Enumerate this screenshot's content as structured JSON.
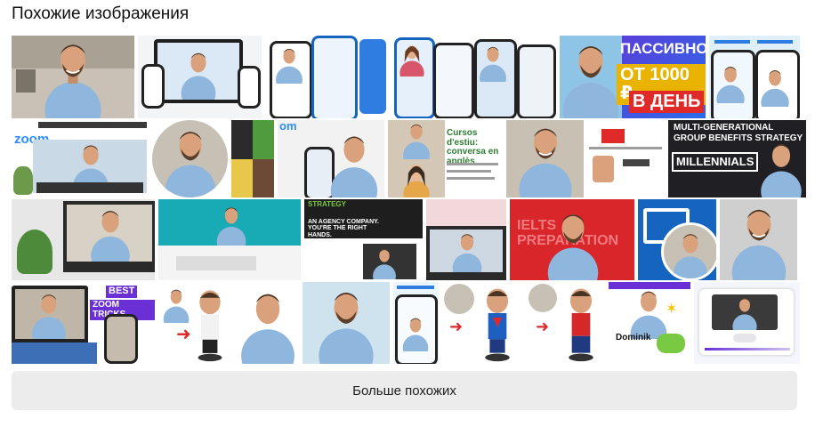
{
  "header": {
    "title": "Похожие изображения"
  },
  "overlays": {
    "passivno_1": "ПАССИВНО",
    "passivno_2": "ОТ 1000 ₽",
    "passivno_3": "В ДЕНЬ",
    "zoom_logo": "zoom",
    "om_logo": "om",
    "cursos_title": "Cursos d'estiu: conversa en anglès",
    "mg_line1": "MULTI-GENERATIONAL",
    "mg_line2": "GROUP BENEFITS STRATEGY",
    "mg_line3": "MILLENNIALS",
    "agency_title": "AN AGENCY COMPANY. YOU'RE THE RIGHT HANDS.",
    "strategy_logo": "STRATEGY",
    "ielts": "IELTS PREPARATION",
    "best_zoom_1": "BEST",
    "best_zoom_2": "ZOOM TRICKS",
    "dominik": "Dominik"
  },
  "actions": {
    "more_label": "Больше похожих"
  },
  "colors": {
    "shirt": "#8fb6dc",
    "skin": "#d9a27c",
    "hair": "#4a3423",
    "purple": "#6b2fd6",
    "red": "#e02a2a",
    "blue": "#1565c0"
  }
}
